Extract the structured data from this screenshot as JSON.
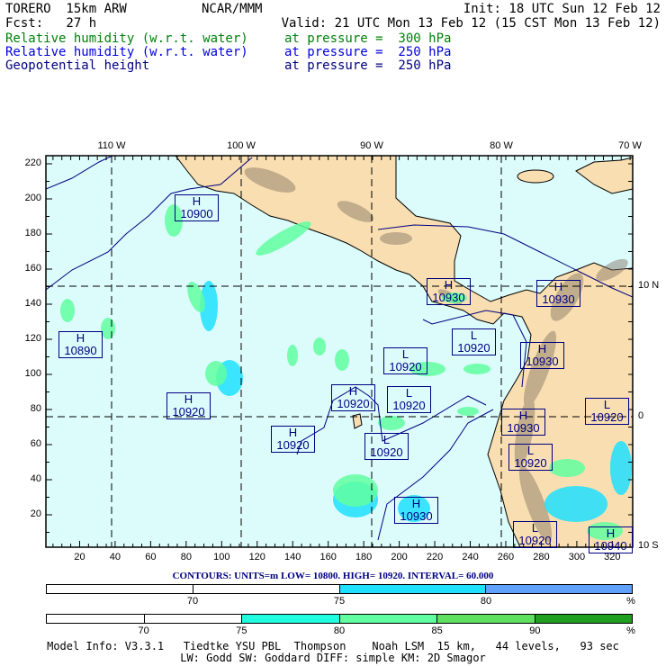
{
  "header": {
    "model": "TORERO  15km ARW",
    "org": "NCAR/MMM",
    "init": "Init: 18 UTC Sun 12 Feb 12",
    "fcst": "Fcst:   27 h",
    "valid": "Valid: 21 UTC Mon 13 Feb 12 (15 CST Mon 13 Feb 12)"
  },
  "fields": [
    {
      "name": "Relative humidity (w.r.t. water)",
      "level": "at pressure =  300 hPa",
      "color": "#00800a"
    },
    {
      "name": "Relative humidity (w.r.t. water)",
      "level": "at pressure =  250 hPa",
      "color": "#0000e0"
    },
    {
      "name": "Geopotential height",
      "level": "at pressure =  250 hPa",
      "color": "#000080"
    }
  ],
  "axes": {
    "x_ticks": [
      "20",
      "40",
      "60",
      "80",
      "100",
      "120",
      "140",
      "160",
      "180",
      "200",
      "220",
      "240",
      "260",
      "280",
      "300",
      "320"
    ],
    "y_ticks": [
      "20",
      "40",
      "60",
      "80",
      "100",
      "120",
      "140",
      "160",
      "180",
      "200",
      "220"
    ],
    "lon_labels": [
      "110 W",
      "100 W",
      "90 W",
      "80 W",
      "70 W"
    ],
    "lat_labels": [
      "10 N",
      "0",
      "10 S"
    ]
  },
  "map_labels": [
    {
      "type": "H",
      "value": "10900"
    },
    {
      "type": "H",
      "value": "10890"
    },
    {
      "type": "H",
      "value": "10920"
    },
    {
      "type": "H",
      "value": "10920"
    },
    {
      "type": "H",
      "value": "10920"
    },
    {
      "type": "L",
      "value": "10920"
    },
    {
      "type": "L",
      "value": "10920"
    },
    {
      "type": "L",
      "value": "10920"
    },
    {
      "type": "H",
      "value": "10930"
    },
    {
      "type": "H",
      "value": "10930"
    },
    {
      "type": "L",
      "value": "10920"
    },
    {
      "type": "H",
      "value": "10930"
    },
    {
      "type": "L",
      "value": "10920"
    },
    {
      "type": "H",
      "value": "10930"
    },
    {
      "type": "L",
      "value": "10920"
    },
    {
      "type": "H",
      "value": "10930"
    },
    {
      "type": "L",
      "value": "10920"
    },
    {
      "type": "H",
      "value": "10940"
    }
  ],
  "contours": "CONTOURS:  UNITS=m  LOW=  10800.     HIGH=  10920.     INTERVAL=    60.000",
  "scale_250": {
    "ticks": [
      "70",
      "75",
      "80"
    ],
    "unit": "%",
    "colors": [
      "#ffffff",
      "#ffffff",
      "#20e0ff",
      "#60a0ff"
    ]
  },
  "scale_300": {
    "ticks": [
      "70",
      "75",
      "80",
      "85",
      "90"
    ],
    "unit": "%",
    "colors": [
      "#ffffff",
      "#ffffff",
      "#20ffe0",
      "#60ffa0",
      "#60e060",
      "#20a020"
    ]
  },
  "footer": {
    "line1": "Model Info: V3.3.1   Tiedtke YSU PBL  Thompson    Noah LSM  15 km,   44 levels,   93 sec",
    "line2": "LW: Godd SW: Goddard DIFF: simple KM: 2D Smagor"
  }
}
